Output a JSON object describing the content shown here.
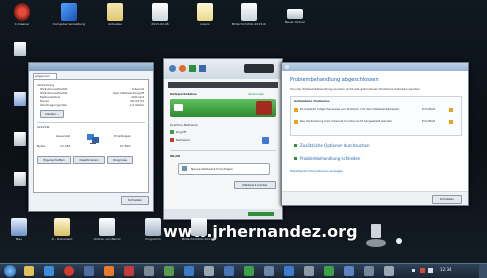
{
  "desktop_icons_top": [
    {
      "icon": "program-icon",
      "label": "C-Cleaner"
    },
    {
      "icon": "control-panel-icon",
      "label": "Computer-Verwaltung"
    },
    {
      "icon": "folder-icon",
      "label": "Aktuelles"
    },
    {
      "icon": "document-icon",
      "label": "2013-02-06"
    },
    {
      "icon": "document-icon",
      "label": "Lizenz"
    },
    {
      "icon": "document-icon",
      "label": "Bildschirmfoto 2013-02-06"
    },
    {
      "icon": "folder-icon",
      "label": "Neuer Ordner"
    }
  ],
  "desktop_icons_bottom": [
    {
      "icon": "document-icon",
      "label": "Neu"
    },
    {
      "icon": "document-icon",
      "label": "D - Dokument"
    },
    {
      "icon": "document-icon",
      "label": "Ordner von Bernd"
    },
    {
      "icon": "program-icon",
      "label": "Programm"
    },
    {
      "icon": "folder-icon",
      "label": "Bildschirmfoto 2013-02-05"
    }
  ],
  "win_left": {
    "tab": "Allgemein",
    "rows": [
      "Verbindung",
      "IPv4-Konnektivität",
      "IPv6-Konnektivität",
      "Medienstatus",
      "Dauer",
      "Übertragungsrate"
    ],
    "values": [
      "Internet",
      "Kein Netzwerkzugriff",
      "Aktiviert",
      "00:03:54",
      "1.0 Gbit/s"
    ],
    "details_btn": "Details...",
    "activity": "Aktivität",
    "sent_label": "Gesendet",
    "recv_label": "Empfangen",
    "bytes_label": "Bytes",
    "sent_value": "12.345",
    "recv_value": "67.890",
    "btn_props": "Eigenschaften",
    "btn_disable": "Deaktivieren",
    "btn_diag": "Diagnose",
    "close_btn": "Schließen"
  },
  "win_mid": {
    "section1": "Netzwerkstatus",
    "status_right": "Verbunden",
    "network_label": "Drahtlos-Netzwerk",
    "item1": "Zugriff",
    "item2": "Netzwerk",
    "section2": "WLAN",
    "button": "Neues Netzwerk hinzufügen",
    "link": "Netzwerk-Center"
  },
  "win_right": {
    "heading": "Problembehandlung abgeschlossen",
    "intro": "Von der Problembehandlung wurden nicht alle gefundenen Probleme behoben werden.",
    "found_label": "Gefundene Probleme",
    "problems": [
      {
        "text": "Es besteht möglicherweise ein Problem mit dem Netzwerkadapter",
        "status": "Ermittelt"
      },
      {
        "text": "Die Verbindung zum Internet konnte nicht hergestellt werden",
        "status": "Ermittelt"
      }
    ],
    "option1": "Zusätzliche Optionen durchsuchen",
    "option2": "Problembehandlung schließen",
    "link": "Detaillierte Informationen anzeigen",
    "close_btn": "Schließen"
  },
  "watermark": "www.jrhernandez.org",
  "taskbar": {
    "clock": "12:34"
  }
}
